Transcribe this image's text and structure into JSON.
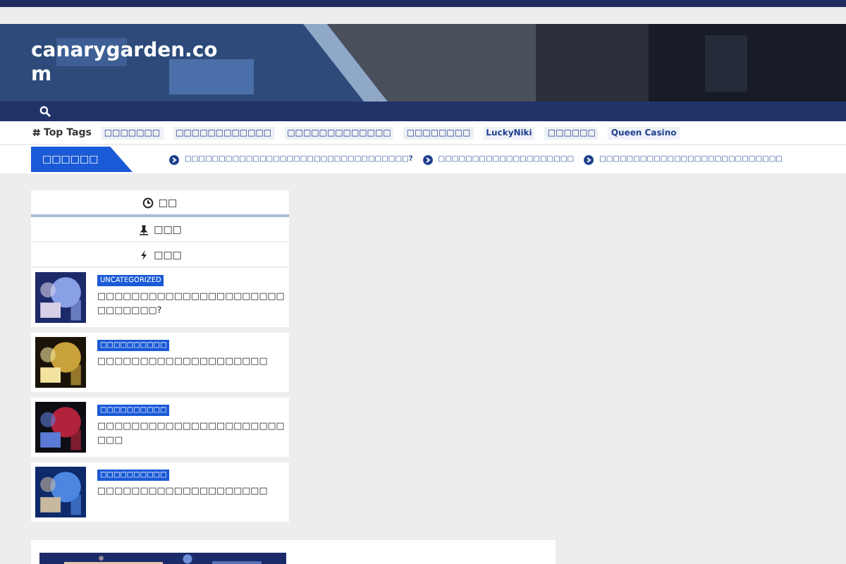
{
  "site": {
    "title": "canarygarden.com"
  },
  "top_tags": {
    "label": "Top Tags",
    "tags": [
      "□□□□□□□",
      "□□□□□□□□□□□□",
      "□□□□□□□□□□□□□",
      "□□□□□□□□",
      "LuckyNiki",
      "□□□□□□",
      "Queen Casino"
    ]
  },
  "ticker": {
    "label": "□□□□□□",
    "items": [
      "□□□□□□□□□□□□□□□□□□□□□□□□□□□□□□□□□?",
      "□□□□□□□□□□□□□□□□□□□□",
      "□□□□□□□□□□□□□□□□□□□□□□□□□□□"
    ]
  },
  "sidebar": {
    "tabs": [
      {
        "label": "□□",
        "kind": "clock",
        "selected": true
      },
      {
        "label": "□□□",
        "kind": "pin",
        "selected": false
      },
      {
        "label": "□□□",
        "kind": "bolt",
        "selected": false
      }
    ],
    "posts": [
      {
        "category": "UNCATEGORIZED",
        "title": "□□□□□□□□□□□□□□□□□□□□□□□□□□□□□?"
      },
      {
        "category": "□□□□□□□□□□",
        "title": "□□□□□□□□□□□□□□□□□□□□"
      },
      {
        "category": "□□□□□□□□□□",
        "title": "□□□□□□□□□□□□□□□□□□□□□□□□□"
      },
      {
        "category": "□□□□□□□□□□",
        "title": "□□□□□□□□□□□□□□□□□□□□"
      }
    ]
  }
}
